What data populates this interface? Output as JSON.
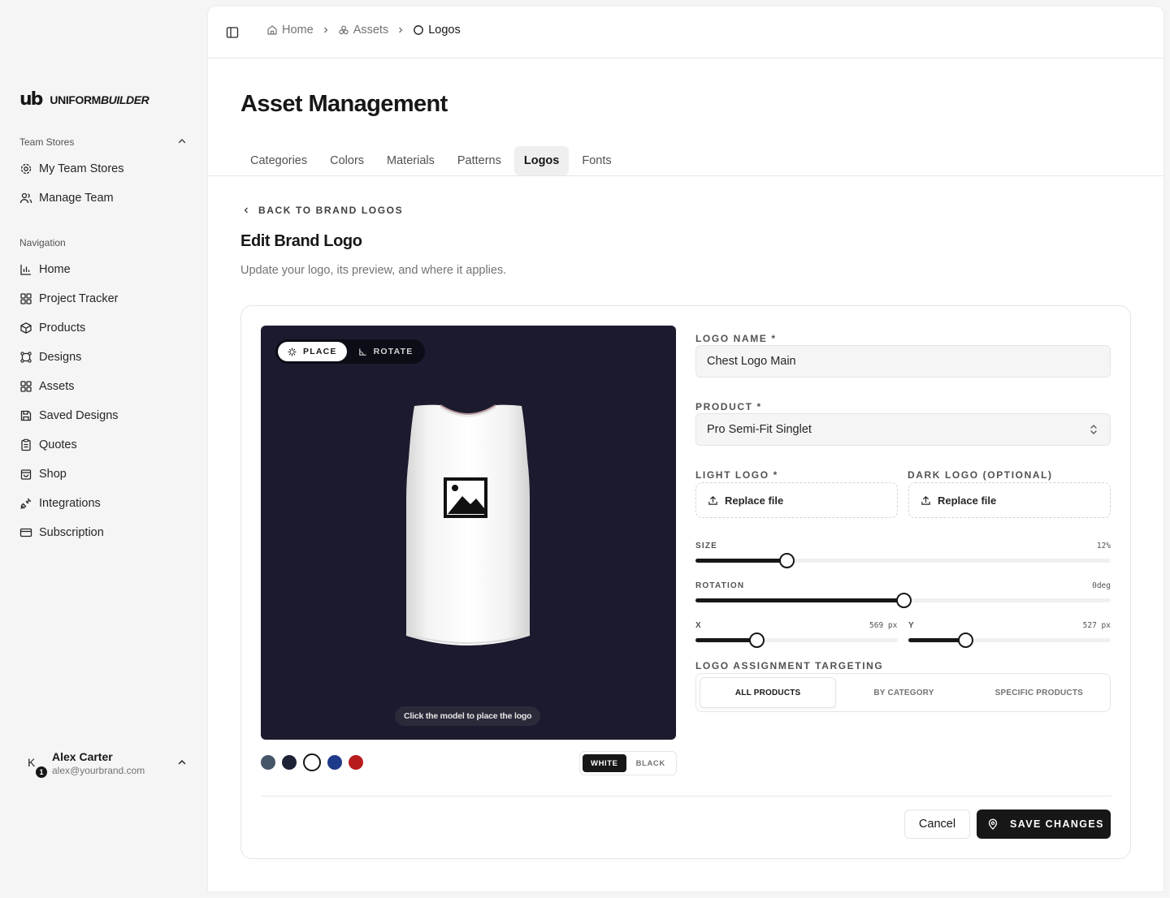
{
  "brand": {
    "mark": "ub",
    "name_regular": "UNIFORM",
    "name_italic": "BUILDER"
  },
  "sidebar": {
    "team_group": {
      "title": "Team Stores",
      "items": [
        {
          "label": "My Team Stores",
          "icon": "store-gear-icon"
        },
        {
          "label": "Manage Team",
          "icon": "users-icon"
        }
      ]
    },
    "nav_group": {
      "title": "Navigation",
      "items": [
        {
          "label": "Home",
          "icon": "chart-icon"
        },
        {
          "label": "Project Tracker",
          "icon": "grid-icon"
        },
        {
          "label": "Products",
          "icon": "box-icon"
        },
        {
          "label": "Designs",
          "icon": "frame-icon"
        },
        {
          "label": "Assets",
          "icon": "grid-icon"
        },
        {
          "label": "Saved Designs",
          "icon": "save-icon"
        },
        {
          "label": "Quotes",
          "icon": "clipboard-icon"
        },
        {
          "label": "Shop",
          "icon": "shopping-bag-icon"
        },
        {
          "label": "Integrations",
          "icon": "plug-icon"
        },
        {
          "label": "Subscription",
          "icon": "card-icon"
        }
      ]
    },
    "user": {
      "initial": "K",
      "badge": "1",
      "name": "Alex Carter",
      "email": "alex@yourbrand.com"
    }
  },
  "breadcrumb": [
    {
      "label": "Home",
      "icon": "home-icon"
    },
    {
      "label": "Assets",
      "icon": "assets-icon"
    },
    {
      "label": "Logos",
      "icon": "circle-icon"
    }
  ],
  "page": {
    "title": "Asset Management",
    "tabs": [
      "Categories",
      "Colors",
      "Materials",
      "Patterns",
      "Logos",
      "Fonts"
    ],
    "active_tab": "Logos"
  },
  "editor": {
    "back_label": "BACK TO BRAND LOGOS",
    "title": "Edit Brand Logo",
    "subtitle": "Update your logo, its preview, and where it applies.",
    "preview": {
      "modes": [
        "PLACE",
        "ROTATE"
      ],
      "active_mode": "PLACE",
      "hint": "Click the model to place the logo",
      "background": "#1b1a2e"
    },
    "garment_colors": [
      "#475569",
      "#1e2235",
      "#ffffff",
      "#1e3a8a",
      "#b91c1c"
    ],
    "selected_color": "#ffffff",
    "tones": [
      "WHITE",
      "BLACK"
    ],
    "active_tone": "WHITE",
    "form": {
      "logo_name_label": "LOGO NAME *",
      "logo_name_value": "Chest Logo Main",
      "product_label": "PRODUCT *",
      "product_value": "Pro Semi-Fit Singlet",
      "light_logo_label": "LIGHT LOGO *",
      "dark_logo_label": "DARK LOGO (OPTIONAL)",
      "replace_label": "Replace file",
      "size": {
        "label": "SIZE",
        "display": "12%",
        "fraction": 0.22
      },
      "rotation": {
        "label": "ROTATION",
        "display": "0deg",
        "fraction": 0.5
      },
      "x": {
        "label": "X",
        "display": "569 px",
        "fraction": 0.3
      },
      "y": {
        "label": "Y",
        "display": "527 px",
        "fraction": 0.28
      },
      "targeting_label": "LOGO ASSIGNMENT TARGETING",
      "targeting_options": [
        "ALL PRODUCTS",
        "BY CATEGORY",
        "SPECIFIC PRODUCTS"
      ],
      "targeting_active": "ALL PRODUCTS"
    },
    "actions": {
      "cancel": "Cancel",
      "save": "SAVE CHANGES"
    }
  }
}
